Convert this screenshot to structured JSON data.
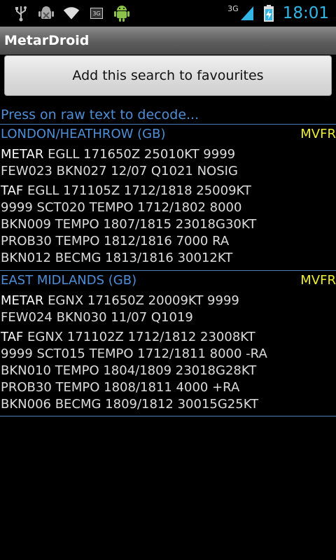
{
  "status_bar": {
    "time": "18:01",
    "network_label": "3G",
    "notification_icons": [
      "usb-icon",
      "android-debug-icon",
      "wifi-icon",
      "sim-3g-icon",
      "android-robot-icon"
    ],
    "accent": "#33b5e5"
  },
  "app": {
    "title": "MetarDroid"
  },
  "favourites_button": {
    "label": "Add this search to favourites"
  },
  "hint": "Press on raw text to decode...",
  "stations": [
    {
      "name": "LONDON/HEATHROW  (GB)",
      "category": "MVFR",
      "metar_label": "METAR",
      "metar_lines": [
        "EGLL 171650Z 25010KT 9999",
        "FEW023 BKN027 12/07 Q1021 NOSIG"
      ],
      "taf_label": "TAF",
      "taf_lines": [
        "EGLL 171105Z 1712/1818 25009KT",
        "9999 SCT020 TEMPO 1712/1802 8000",
        "BKN009 TEMPO 1807/1815 23018G30KT",
        "PROB30 TEMPO 1812/1816 7000 RA",
        "BKN012 BECMG 1813/1816 30012KT"
      ]
    },
    {
      "name": "EAST MIDLANDS  (GB)",
      "category": "MVFR",
      "metar_label": "METAR",
      "metar_lines": [
        "EGNX 171650Z 20009KT 9999",
        "FEW024 BKN030 11/07 Q1019"
      ],
      "taf_label": "TAF",
      "taf_lines": [
        "EGNX 171102Z 1712/1812 23008KT",
        "9999 SCT015 TEMPO 1712/1811 8000 -RA",
        "BKN010 TEMPO 1804/1809 23018G28KT",
        "PROB30 TEMPO 1808/1811 4000 +RA",
        "BKN006 BECMG 1809/1812 30015G25KT"
      ]
    }
  ]
}
